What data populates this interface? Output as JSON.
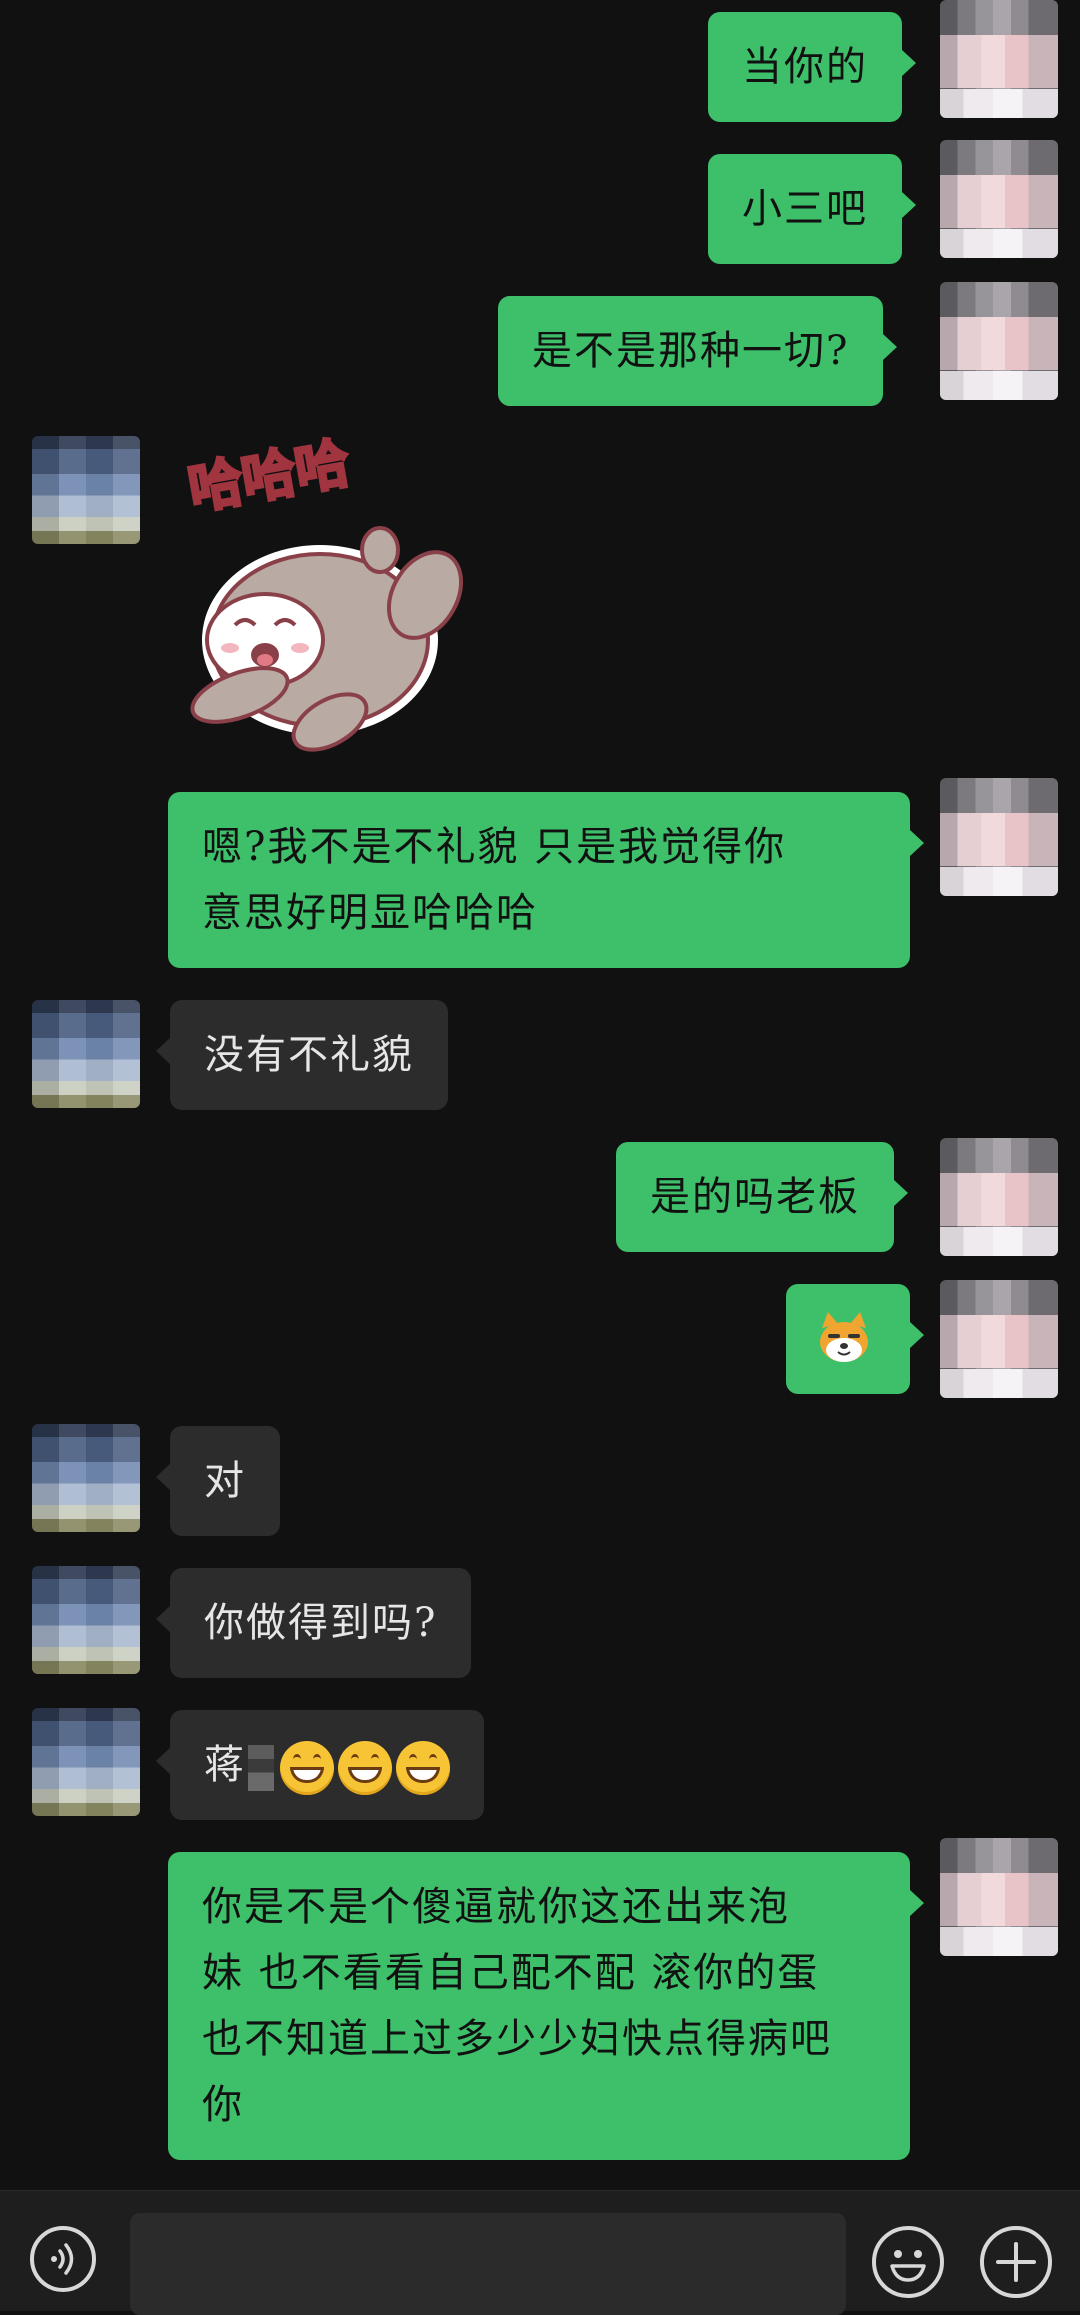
{
  "messages": [
    {
      "side": "me",
      "type": "text",
      "text": "当你的"
    },
    {
      "side": "me",
      "type": "text",
      "text": "小三吧"
    },
    {
      "side": "me",
      "type": "text",
      "text": "是不是那种一切?"
    },
    {
      "side": "other",
      "type": "sticker",
      "sticker_text": "哈哈哈",
      "sticker_icon": "laughing-bear-sticker"
    },
    {
      "side": "me",
      "type": "text",
      "lines": [
        "嗯?我不是不礼貌 只是我觉得你",
        "意思好明显哈哈哈"
      ]
    },
    {
      "side": "other",
      "type": "text",
      "text": "没有不礼貌"
    },
    {
      "side": "me",
      "type": "text",
      "text": "是的吗老板"
    },
    {
      "side": "me",
      "type": "emoji",
      "icon": "shiba-dog-emoji"
    },
    {
      "side": "other",
      "type": "text",
      "text": "对"
    },
    {
      "side": "other",
      "type": "text",
      "text": "你做得到吗?"
    },
    {
      "side": "other",
      "type": "text",
      "text": "蒋",
      "suffix_icons": [
        "grinning-face-emoji",
        "grinning-face-emoji",
        "grinning-face-emoji"
      ]
    },
    {
      "side": "me",
      "type": "text",
      "lines": [
        "你是不是个傻逼就你这还出来泡",
        "妹 也不看看自己配不配 滚你的蛋",
        "也不知道上过多少少妇快点得病吧",
        "你"
      ]
    }
  ],
  "input_bar": {
    "voice_icon": "voice-icon",
    "emoji_icon": "emoji-face-icon",
    "plus_icon": "plus-icon",
    "input_value": ""
  },
  "colors": {
    "background": "#111111",
    "my_bubble": "#3ebf6a",
    "their_bubble": "#2c2c2c"
  }
}
